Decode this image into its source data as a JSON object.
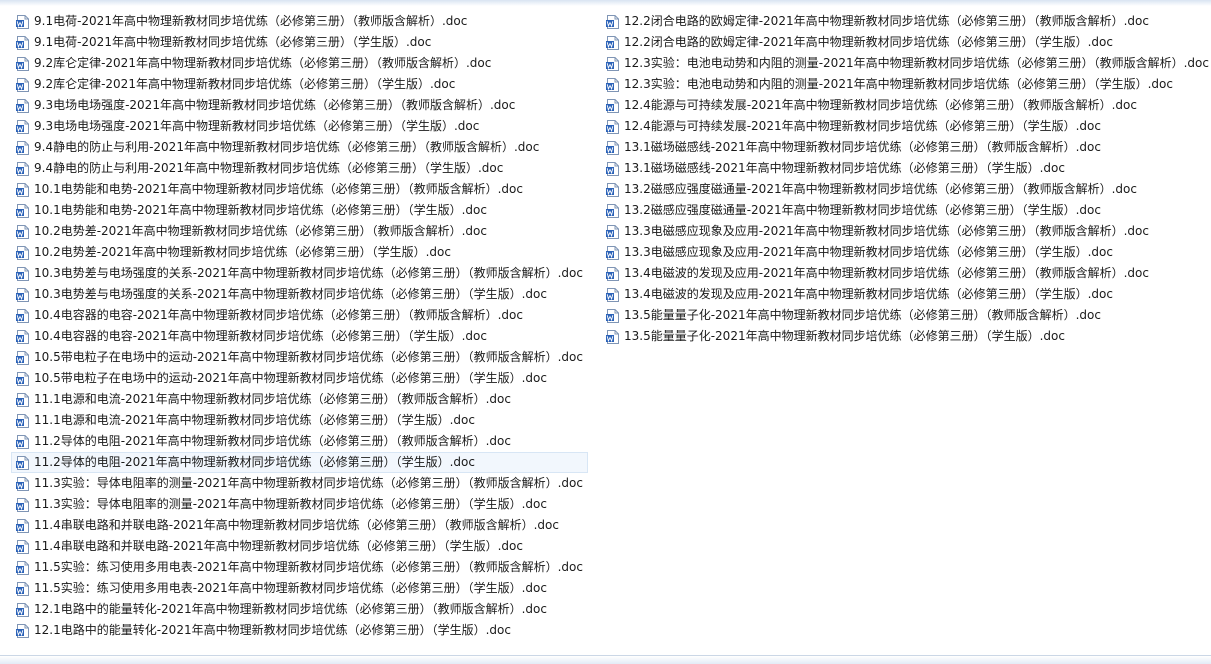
{
  "files_left": [
    "9.1电荷-2021年高中物理新教材同步培优练（必修第三册）（教师版含解析）.doc",
    "9.1电荷-2021年高中物理新教材同步培优练（必修第三册）（学生版）.doc",
    "9.2库仑定律-2021年高中物理新教材同步培优练（必修第三册）（教师版含解析）.doc",
    "9.2库仑定律-2021年高中物理新教材同步培优练（必修第三册）（学生版）.doc",
    "9.3电场电场强度-2021年高中物理新教材同步培优练（必修第三册）（教师版含解析）.doc",
    "9.3电场电场强度-2021年高中物理新教材同步培优练（必修第三册）（学生版）.doc",
    "9.4静电的防止与利用-2021年高中物理新教材同步培优练（必修第三册）（教师版含解析）.doc",
    "9.4静电的防止与利用-2021年高中物理新教材同步培优练（必修第三册）（学生版）.doc",
    "10.1电势能和电势-2021年高中物理新教材同步培优练（必修第三册）（教师版含解析）.doc",
    "10.1电势能和电势-2021年高中物理新教材同步培优练（必修第三册）（学生版）.doc",
    "10.2电势差-2021年高中物理新教材同步培优练（必修第三册）（教师版含解析）.doc",
    "10.2电势差-2021年高中物理新教材同步培优练（必修第三册）（学生版）.doc",
    "10.3电势差与电场强度的关系-2021年高中物理新教材同步培优练（必修第三册）（教师版含解析）.doc",
    "10.3电势差与电场强度的关系-2021年高中物理新教材同步培优练（必修第三册）（学生版）.doc",
    "10.4电容器的电容-2021年高中物理新教材同步培优练（必修第三册）（教师版含解析）.doc",
    "10.4电容器的电容-2021年高中物理新教材同步培优练（必修第三册）（学生版）.doc",
    "10.5带电粒子在电场中的运动-2021年高中物理新教材同步培优练（必修第三册）（教师版含解析）.doc",
    "10.5带电粒子在电场中的运动-2021年高中物理新教材同步培优练（必修第三册）（学生版）.doc",
    "11.1电源和电流-2021年高中物理新教材同步培优练（必修第三册）（教师版含解析）.doc",
    "11.1电源和电流-2021年高中物理新教材同步培优练（必修第三册）（学生版）.doc",
    "11.2导体的电阻-2021年高中物理新教材同步培优练（必修第三册）（教师版含解析）.doc",
    "11.2导体的电阻-2021年高中物理新教材同步培优练（必修第三册）（学生版）.doc",
    "11.3实验：导体电阻率的测量-2021年高中物理新教材同步培优练（必修第三册）（教师版含解析）.doc",
    "11.3实验：导体电阻率的测量-2021年高中物理新教材同步培优练（必修第三册）（学生版）.doc",
    "11.4串联电路和并联电路-2021年高中物理新教材同步培优练（必修第三册）（教师版含解析）.doc",
    "11.4串联电路和并联电路-2021年高中物理新教材同步培优练（必修第三册）（学生版）.doc",
    "11.5实验：练习使用多用电表-2021年高中物理新教材同步培优练（必修第三册）（教师版含解析）.doc",
    "11.5实验：练习使用多用电表-2021年高中物理新教材同步培优练（必修第三册）（学生版）.doc",
    "12.1电路中的能量转化-2021年高中物理新教材同步培优练（必修第三册）（教师版含解析）.doc",
    "12.1电路中的能量转化-2021年高中物理新教材同步培优练（必修第三册）（学生版）.doc"
  ],
  "files_right": [
    "12.2闭合电路的欧姆定律-2021年高中物理新教材同步培优练（必修第三册）（教师版含解析）.doc",
    "12.2闭合电路的欧姆定律-2021年高中物理新教材同步培优练（必修第三册）（学生版）.doc",
    "12.3实验：电池电动势和内阻的测量-2021年高中物理新教材同步培优练（必修第三册）（教师版含解析）.doc",
    "12.3实验：电池电动势和内阻的测量-2021年高中物理新教材同步培优练（必修第三册）（学生版）.doc",
    "12.4能源与可持续发展-2021年高中物理新教材同步培优练（必修第三册）（教师版含解析）.doc",
    "12.4能源与可持续发展-2021年高中物理新教材同步培优练（必修第三册）（学生版）.doc",
    "13.1磁场磁感线-2021年高中物理新教材同步培优练（必修第三册）（教师版含解析）.doc",
    "13.1磁场磁感线-2021年高中物理新教材同步培优练（必修第三册）（学生版）.doc",
    "13.2磁感应强度磁通量-2021年高中物理新教材同步培优练（必修第三册）（教师版含解析）.doc",
    "13.2磁感应强度磁通量-2021年高中物理新教材同步培优练（必修第三册）（学生版）.doc",
    "13.3电磁感应现象及应用-2021年高中物理新教材同步培优练（必修第三册）（教师版含解析）.doc",
    "13.3电磁感应现象及应用-2021年高中物理新教材同步培优练（必修第三册）（学生版）.doc",
    "13.4电磁波的发现及应用-2021年高中物理新教材同步培优练（必修第三册）（教师版含解析）.doc",
    "13.4电磁波的发现及应用-2021年高中物理新教材同步培优练（必修第三册）（学生版）.doc",
    "13.5能量量子化-2021年高中物理新教材同步培优练（必修第三册）（教师版含解析）.doc",
    "13.5能量量子化-2021年高中物理新教材同步培优练（必修第三册）（学生版）.doc"
  ],
  "selected_file": "11.2导体的电阻-2021年高中物理新教材同步培优练（必修第三册）（学生版）.doc",
  "file_icon": "word-doc-icon",
  "colors": {
    "icon_blue": "#2b62b8",
    "selection_bg": "#f2f7fd",
    "selection_border": "#d8e6f5",
    "text": "#1a1a1a"
  }
}
